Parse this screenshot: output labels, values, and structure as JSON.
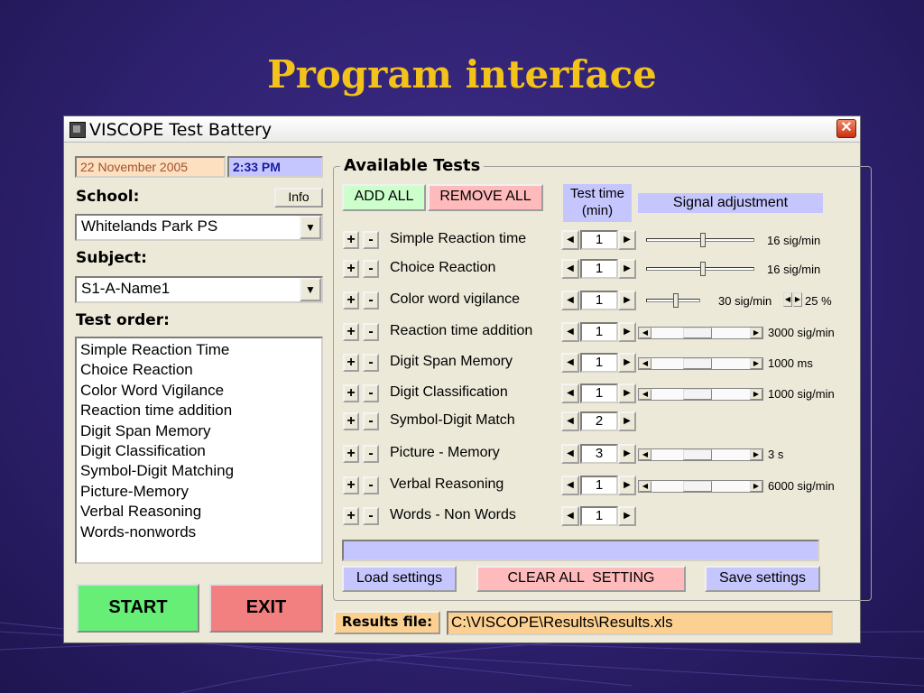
{
  "slide": {
    "title": "Program interface"
  },
  "window": {
    "title": "VISCOPE Test Battery",
    "close": "✕"
  },
  "left": {
    "date": "22 November 2005",
    "time": "2:33 PM",
    "school_label": "School:",
    "info_button": "Info",
    "school_value": "Whitelands Park PS",
    "subject_label": "Subject:",
    "subject_value": "S1-A-Name1",
    "order_label": "Test order:",
    "order_items": [
      "Simple Reaction Time",
      "Choice Reaction",
      "Color Word Vigilance",
      "Reaction time addition",
      "Digit Span Memory",
      "Digit Classification",
      "Symbol-Digit Matching",
      "Picture-Memory",
      "Verbal Reasoning",
      "Words-nonwords"
    ],
    "start_button": "START",
    "exit_button": "EXIT"
  },
  "tests": {
    "group_title": "Available Tests",
    "add_all": "ADD ALL",
    "remove_all": "REMOVE ALL",
    "test_time_header": "Test time (min)",
    "signal_header": "Signal adjustment",
    "plus": "+",
    "minus": "-",
    "rows": [
      {
        "name": "Simple Reaction time",
        "time": "1",
        "control": "slider",
        "level": 0.53,
        "rate": "16 sig/min"
      },
      {
        "name": "Choice Reaction",
        "time": "1",
        "control": "slider",
        "level": 0.53,
        "rate": "16 sig/min"
      },
      {
        "name": "Color word vigilance",
        "time": "1",
        "control": "slider",
        "level": 0.55,
        "rate": "30 sig/min",
        "extra": "25 %"
      },
      {
        "name": "Reaction time addition",
        "time": "1",
        "control": "scroll",
        "level": 0.45,
        "rate": "3000 sig/min"
      },
      {
        "name": "Digit Span Memory",
        "time": "1",
        "control": "scroll",
        "level": 0.45,
        "rate": "1000 ms"
      },
      {
        "name": "Digit Classification",
        "time": "1",
        "control": "scroll",
        "level": 0.45,
        "rate": "1000 sig/min"
      },
      {
        "name": "Symbol-Digit Match",
        "time": "2",
        "control": "none"
      },
      {
        "name": "Picture - Memory",
        "time": "3",
        "control": "scroll",
        "level": 0.45,
        "rate": "3 s"
      },
      {
        "name": "Verbal Reasoning",
        "time": "1",
        "control": "scroll",
        "level": 0.45,
        "rate": "6000 sig/min"
      },
      {
        "name": "Words - Non Words",
        "time": "1",
        "control": "none"
      }
    ],
    "load_settings": "Load settings",
    "clear_all": "CLEAR ALL  SETTING",
    "save_settings": "Save settings"
  },
  "results": {
    "label": "Results file:",
    "path": "C:\\VISCOPE\\Results\\Results.xls"
  },
  "colors": {
    "accent_title": "#f3c21b",
    "start": "#66ee77",
    "exit": "#f38080",
    "lavender": "#c6c6ff",
    "add": "#ccffcc",
    "remove": "#ffbbbb"
  }
}
